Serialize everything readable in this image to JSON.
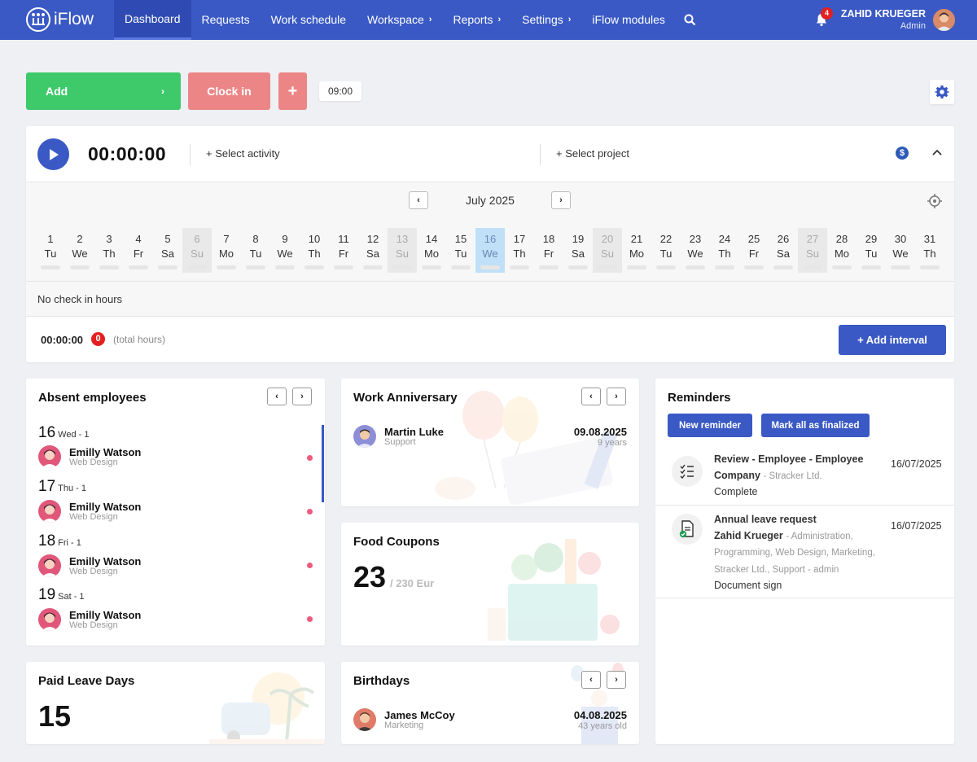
{
  "app": {
    "logo_text": "iFlow"
  },
  "nav": {
    "items": [
      {
        "label": "Dashboard",
        "active": true,
        "chevron": false
      },
      {
        "label": "Requests",
        "active": false,
        "chevron": false
      },
      {
        "label": "Work schedule",
        "active": false,
        "chevron": false
      },
      {
        "label": "Workspace",
        "active": false,
        "chevron": true
      },
      {
        "label": "Reports",
        "active": false,
        "chevron": true
      },
      {
        "label": "Settings",
        "active": false,
        "chevron": true
      },
      {
        "label": "iFlow modules",
        "active": false,
        "chevron": false
      }
    ],
    "notifications_count": "4",
    "user_name": "ZAHID KRUEGER",
    "user_role": "Admin"
  },
  "actions": {
    "add_label": "Add",
    "clock_in_label": "Clock in",
    "plus_label": "+",
    "time_chip": "09:00"
  },
  "timer": {
    "value": "00:00:00",
    "select_activity": "+ Select activity",
    "select_project": "+ Select project",
    "currency_icon": "dollar-circle-icon"
  },
  "calendar": {
    "month": "July 2025",
    "days": [
      {
        "n": "1",
        "w": "Tu",
        "type": "normal"
      },
      {
        "n": "2",
        "w": "We",
        "type": "normal"
      },
      {
        "n": "3",
        "w": "Th",
        "type": "normal"
      },
      {
        "n": "4",
        "w": "Fr",
        "type": "normal"
      },
      {
        "n": "5",
        "w": "Sa",
        "type": "normal"
      },
      {
        "n": "6",
        "w": "Su",
        "type": "weekend"
      },
      {
        "n": "7",
        "w": "Mo",
        "type": "normal"
      },
      {
        "n": "8",
        "w": "Tu",
        "type": "normal"
      },
      {
        "n": "9",
        "w": "We",
        "type": "normal"
      },
      {
        "n": "10",
        "w": "Th",
        "type": "normal"
      },
      {
        "n": "11",
        "w": "Fr",
        "type": "normal"
      },
      {
        "n": "12",
        "w": "Sa",
        "type": "normal"
      },
      {
        "n": "13",
        "w": "Su",
        "type": "weekend"
      },
      {
        "n": "14",
        "w": "Mo",
        "type": "normal"
      },
      {
        "n": "15",
        "w": "Tu",
        "type": "normal"
      },
      {
        "n": "16",
        "w": "We",
        "type": "today"
      },
      {
        "n": "17",
        "w": "Th",
        "type": "normal"
      },
      {
        "n": "18",
        "w": "Fr",
        "type": "normal"
      },
      {
        "n": "19",
        "w": "Sa",
        "type": "normal"
      },
      {
        "n": "20",
        "w": "Su",
        "type": "weekend"
      },
      {
        "n": "21",
        "w": "Mo",
        "type": "normal"
      },
      {
        "n": "22",
        "w": "Tu",
        "type": "normal"
      },
      {
        "n": "23",
        "w": "We",
        "type": "normal"
      },
      {
        "n": "24",
        "w": "Th",
        "type": "normal"
      },
      {
        "n": "25",
        "w": "Fr",
        "type": "normal"
      },
      {
        "n": "26",
        "w": "Sa",
        "type": "normal"
      },
      {
        "n": "27",
        "w": "Su",
        "type": "weekend"
      },
      {
        "n": "28",
        "w": "Mo",
        "type": "normal"
      },
      {
        "n": "29",
        "w": "Tu",
        "type": "normal"
      },
      {
        "n": "30",
        "w": "We",
        "type": "normal"
      },
      {
        "n": "31",
        "w": "Th",
        "type": "normal"
      }
    ],
    "no_check_in": "No check in hours",
    "total_time": "00:00:00",
    "total_count": "0",
    "total_label": "(total hours)",
    "add_interval_label": "+ Add interval"
  },
  "absent": {
    "title": "Absent employees",
    "days": [
      {
        "day": "16",
        "sub": "Wed - 1",
        "name": "Emilly Watson",
        "dept": "Web Design"
      },
      {
        "day": "17",
        "sub": "Thu - 1",
        "name": "Emilly Watson",
        "dept": "Web Design"
      },
      {
        "day": "18",
        "sub": "Fri - 1",
        "name": "Emilly Watson",
        "dept": "Web Design"
      },
      {
        "day": "19",
        "sub": "Sat - 1",
        "name": "Emilly Watson",
        "dept": "Web Design"
      }
    ]
  },
  "anniversary": {
    "title": "Work Anniversary",
    "name": "Martin Luke",
    "dept": "Support",
    "date": "09.08.2025",
    "years": "9 years"
  },
  "food": {
    "title": "Food Coupons",
    "value": "23",
    "total": "/ 230 Eur"
  },
  "paid_leave": {
    "title": "Paid Leave Days",
    "value": "15"
  },
  "birthdays": {
    "title": "Birthdays",
    "name": "James McCoy",
    "dept": "Marketing",
    "date": "04.08.2025",
    "age": "43 years old"
  },
  "reminders": {
    "title": "Reminders",
    "new_label": "New reminder",
    "mark_label": "Mark all as finalized",
    "items": [
      {
        "title": "Review - Employee - Employee Company",
        "sub": "- Stracker Ltd.",
        "status": "Complete",
        "date": "16/07/2025"
      },
      {
        "title": "Annual leave request",
        "name": "Zahid Krueger",
        "sub": "- Administration, Programming, Web Design, Marketing, Stracker Ltd., Support - admin",
        "status": "Document sign",
        "date": "16/07/2025"
      }
    ]
  }
}
